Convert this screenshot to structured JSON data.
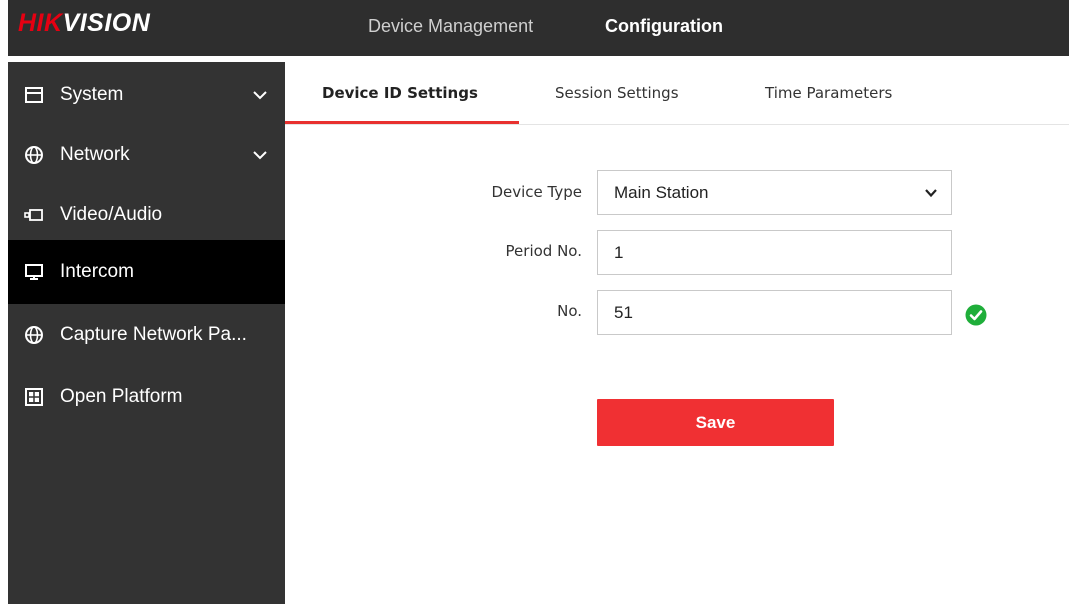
{
  "header": {
    "logo_part1": "HIK",
    "logo_part2": "VISION",
    "nav": [
      {
        "label": "Device Management",
        "active": false
      },
      {
        "label": "Configuration",
        "active": true
      }
    ]
  },
  "sidebar": {
    "items": [
      {
        "label": "System",
        "icon": "window-icon",
        "expandable": true,
        "active": false
      },
      {
        "label": "Network",
        "icon": "globe-icon",
        "expandable": true,
        "active": false
      },
      {
        "label": "Video/Audio",
        "icon": "camera-icon",
        "expandable": false,
        "active": false
      },
      {
        "label": "Intercom",
        "icon": "monitor-icon",
        "expandable": false,
        "active": true
      },
      {
        "label": "Capture Network Pa...",
        "icon": "globe-icon",
        "expandable": false,
        "active": false
      },
      {
        "label": "Open Platform",
        "icon": "grid-icon",
        "expandable": false,
        "active": false
      }
    ]
  },
  "tabs": [
    {
      "label": "Device ID Settings",
      "active": true
    },
    {
      "label": "Session Settings",
      "active": false
    },
    {
      "label": "Time Parameters",
      "active": false
    }
  ],
  "form": {
    "device_type": {
      "label": "Device Type",
      "value": "Main Station"
    },
    "period_no": {
      "label": "Period No.",
      "value": "1"
    },
    "no": {
      "label": "No.",
      "value": "51",
      "status": "valid"
    },
    "save_label": "Save"
  },
  "colors": {
    "brand_red": "#e60012",
    "accent_red": "#f03033",
    "tab_underline": "#e8312f",
    "valid_green": "#1fae3a",
    "sidebar_bg": "#333333",
    "sidebar_active_bg": "#000000",
    "topbar_bg": "#2e2e2e"
  }
}
